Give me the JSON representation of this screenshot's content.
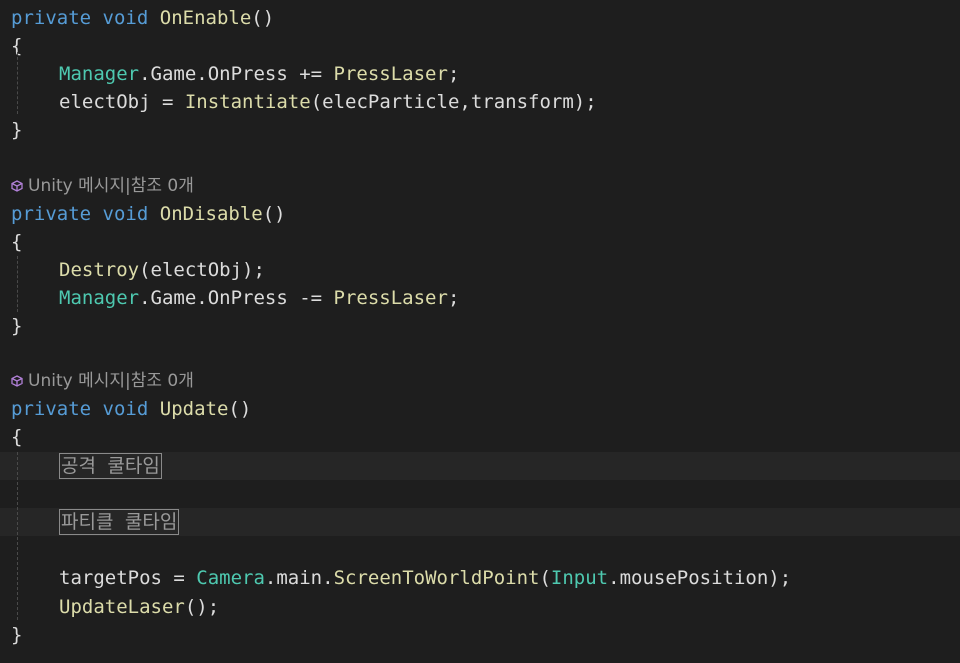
{
  "codelens_text": "Unity 메시지|참조 0개",
  "colors": {
    "background": "#1e1e1e",
    "keyword": "#569cd6",
    "method": "#dcdcaa",
    "type": "#4ec9b0",
    "text": "#dcdcdc",
    "codelens": "#999999"
  },
  "blocks": {
    "on_enable": {
      "signature": {
        "kw1": "private",
        "kw2": "void",
        "name": "OnEnable",
        "parens": "()"
      },
      "open": "{",
      "line1": {
        "type": "Manager",
        "rest1": ".Game.OnPress += ",
        "method": "PressLaser",
        "end": ";"
      },
      "line2": {
        "lhs": "electObj = ",
        "method": "Instantiate",
        "args": "(elecParticle,transform);"
      },
      "close": "}"
    },
    "on_disable": {
      "signature": {
        "kw1": "private",
        "kw2": "void",
        "name": "OnDisable",
        "parens": "()"
      },
      "open": "{",
      "line1": {
        "method": "Destroy",
        "args": "(electObj);"
      },
      "line2": {
        "type": "Manager",
        "rest1": ".Game.OnPress -= ",
        "method": "PressLaser",
        "end": ";"
      },
      "close": "}"
    },
    "update": {
      "signature": {
        "kw1": "private",
        "kw2": "void",
        "name": "Update",
        "parens": "()"
      },
      "open": "{",
      "region1": "공격 쿨타임",
      "region2": "파티클 쿨타임",
      "line1": {
        "lhs": "targetPos = ",
        "type1": "Camera",
        "mid1": ".main.",
        "method": "ScreenToWorldPoint",
        "paren": "(",
        "type2": "Input",
        "end": ".mousePosition);"
      },
      "line2": {
        "method": "UpdateLaser",
        "end": "();"
      },
      "close": "}"
    }
  }
}
